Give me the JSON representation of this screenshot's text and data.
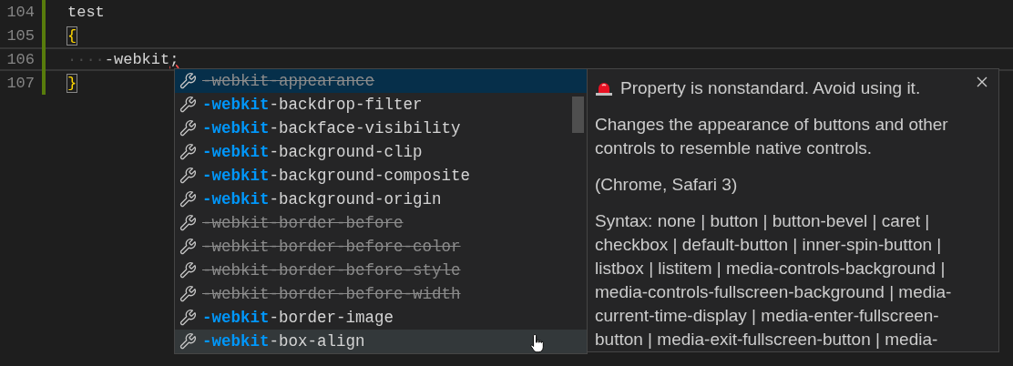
{
  "editor": {
    "lines": [
      {
        "number": "104",
        "text": "test",
        "kind": "plain",
        "current": false
      },
      {
        "number": "105",
        "text": "{",
        "kind": "bracket",
        "current": false
      },
      {
        "number": "106",
        "indent": "····",
        "text": "-webkit",
        "suffix": ";",
        "kind": "error",
        "current": true
      },
      {
        "number": "107",
        "text": "}",
        "kind": "bracket",
        "current": false
      }
    ]
  },
  "suggestions": {
    "items": [
      {
        "match": "-webkit",
        "rest": "-appearance",
        "deprecated": true,
        "selected": true,
        "hovered": false
      },
      {
        "match": "-webkit",
        "rest": "-backdrop-filter",
        "deprecated": false,
        "selected": false,
        "hovered": false
      },
      {
        "match": "-webkit",
        "rest": "-backface-visibility",
        "deprecated": false,
        "selected": false,
        "hovered": false
      },
      {
        "match": "-webkit",
        "rest": "-background-clip",
        "deprecated": false,
        "selected": false,
        "hovered": false
      },
      {
        "match": "-webkit",
        "rest": "-background-composite",
        "deprecated": false,
        "selected": false,
        "hovered": false
      },
      {
        "match": "-webkit",
        "rest": "-background-origin",
        "deprecated": false,
        "selected": false,
        "hovered": false
      },
      {
        "match": "-webkit",
        "rest": "-border-before",
        "deprecated": true,
        "selected": false,
        "hovered": false
      },
      {
        "match": "-webkit",
        "rest": "-border-before-color",
        "deprecated": true,
        "selected": false,
        "hovered": false
      },
      {
        "match": "-webkit",
        "rest": "-border-before-style",
        "deprecated": true,
        "selected": false,
        "hovered": false
      },
      {
        "match": "-webkit",
        "rest": "-border-before-width",
        "deprecated": true,
        "selected": false,
        "hovered": false
      },
      {
        "match": "-webkit",
        "rest": "-border-image",
        "deprecated": false,
        "selected": false,
        "hovered": false
      },
      {
        "match": "-webkit",
        "rest": "-box-align",
        "deprecated": false,
        "selected": false,
        "hovered": true
      }
    ]
  },
  "details": {
    "warning": "Property is nonstandard. Avoid using it.",
    "description": "Changes the appearance of buttons and other controls to resemble native controls.",
    "browsers": "(Chrome, Safari 3)",
    "syntax_lines": [
      "Syntax: none | button | button-bevel | caret |",
      "checkbox | default-button | inner-spin-button |",
      "listbox | listitem | media-controls-background |",
      "media-controls-fullscreen-background | media-",
      "current-time-display | media-enter-fullscreen-",
      "button | media-exit-fullscreen-button | media-"
    ]
  }
}
